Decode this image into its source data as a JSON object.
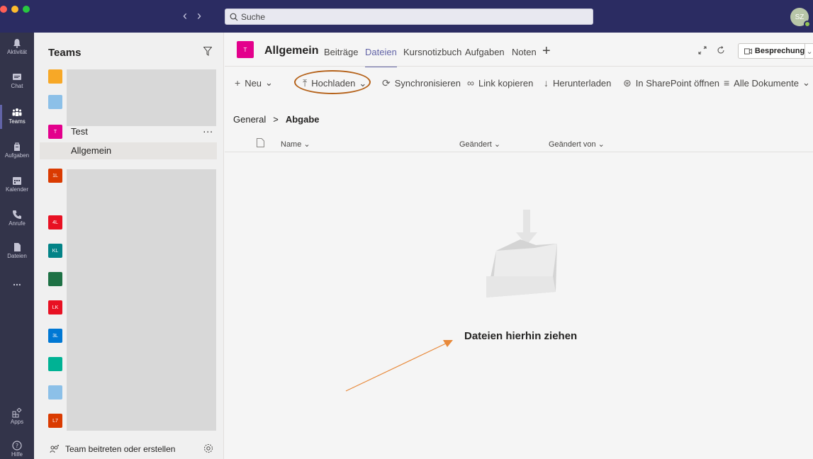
{
  "titlebar": {
    "search": {
      "placeholder": "Suche"
    },
    "avatar_initials": "SZ",
    "colors": {
      "bg": "#2b2c62"
    }
  },
  "rail": {
    "items": [
      {
        "label": "Aktivität",
        "icon": "bell-icon"
      },
      {
        "label": "Chat",
        "icon": "chat-icon"
      },
      {
        "label": "Teams",
        "icon": "teams-icon"
      },
      {
        "label": "Aufgaben",
        "icon": "assignments-icon"
      },
      {
        "label": "Kalender",
        "icon": "calendar-icon"
      },
      {
        "label": "Anrufe",
        "icon": "phone-icon"
      },
      {
        "label": "Dateien",
        "icon": "file-icon"
      },
      {
        "label": "...",
        "icon": "more-icon"
      },
      {
        "label": "Apps",
        "icon": "apps-icon"
      },
      {
        "label": "Hilfe",
        "icon": "help-icon"
      }
    ]
  },
  "teams_panel": {
    "title": "Teams",
    "teams": [
      {
        "initials": "",
        "color": "#f7a827"
      },
      {
        "initials": "",
        "color": "#8cc0e8"
      },
      {
        "initials": "T",
        "color": "#e3008c",
        "name": "Test"
      },
      {
        "initials": "1L",
        "color": "#da3b01"
      },
      {
        "initials": "4L",
        "color": "#e81123"
      },
      {
        "initials": "KL",
        "color": "#038387"
      },
      {
        "initials": "",
        "color": "#1e7145"
      },
      {
        "initials": "LK",
        "color": "#e81123"
      },
      {
        "initials": "3L",
        "color": "#0078d4"
      },
      {
        "initials": "",
        "color": "#00b294"
      },
      {
        "initials": "",
        "color": "#8cc0e8"
      },
      {
        "initials": "L7",
        "color": "#da3b01"
      }
    ],
    "more": "...",
    "active_channel": "Allgemein",
    "join_label": "Team beitreten oder erstellen"
  },
  "channel": {
    "tile_initial": "T",
    "title": "Allgemein",
    "tabs": [
      {
        "label": "Beiträge",
        "active": false
      },
      {
        "label": "Dateien",
        "active": true
      },
      {
        "label": "Kursnotizbuch",
        "active": false
      },
      {
        "label": "Aufgaben",
        "active": false
      },
      {
        "label": "Noten",
        "active": false
      }
    ],
    "add_tab": "+",
    "meet_label": "Besprechung"
  },
  "toolbar": {
    "new": "Neu",
    "upload": "Hochladen",
    "sync": "Synchronisieren",
    "copy_link": "Link kopieren",
    "download": "Herunterladen",
    "sharepoint": "In SharePoint öffnen",
    "all_docs": "Alle Dokumente"
  },
  "breadcrumb": {
    "root": "General",
    "separator": ">",
    "current": "Abgabe"
  },
  "columns": {
    "name": "Name",
    "modified": "Geändert",
    "modified_by": "Geändert von"
  },
  "empty_state": {
    "text": "Dateien hierhin ziehen"
  },
  "annotation": {
    "color": "#e8893a"
  }
}
